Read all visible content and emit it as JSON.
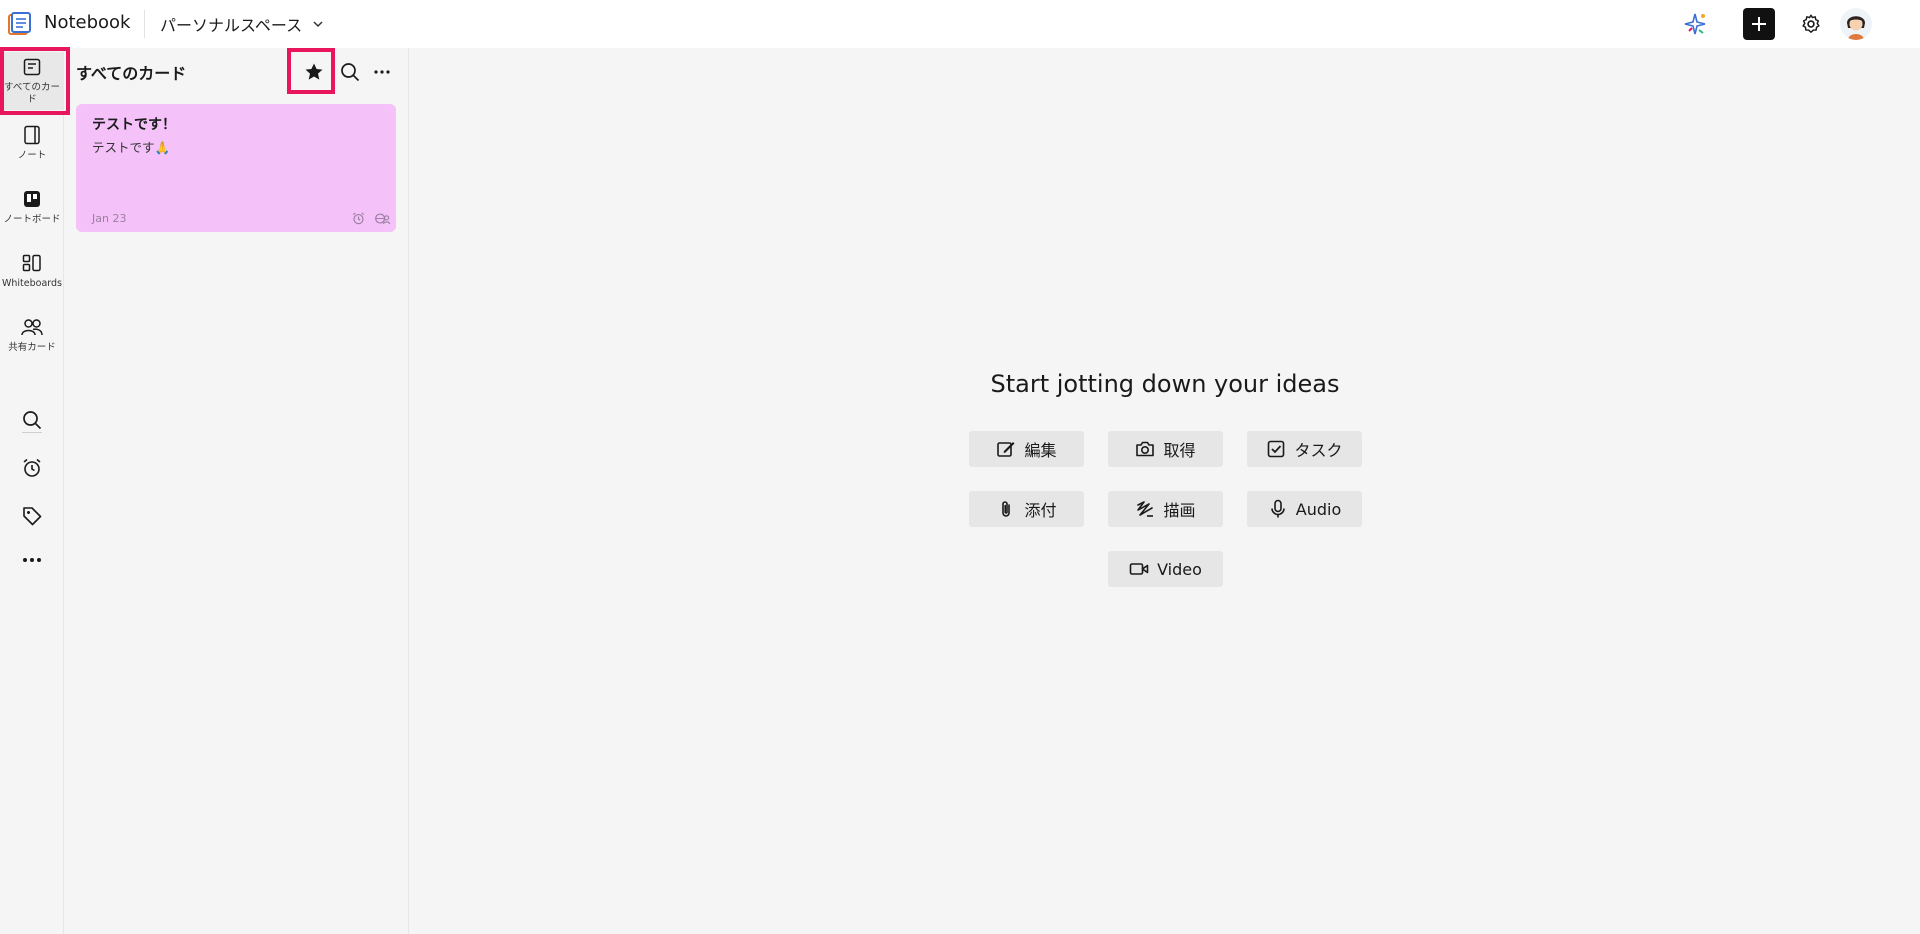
{
  "app": {
    "name": "Notebook",
    "space": "パーソナルスペース"
  },
  "nav": {
    "items": [
      {
        "label": "すべてのカード",
        "icon": "cards-icon"
      },
      {
        "label": "ノート",
        "icon": "notebook-icon"
      },
      {
        "label": "ノートボード",
        "icon": "board-icon"
      },
      {
        "label": "Whiteboards",
        "icon": "whiteboard-icon"
      },
      {
        "label": "共有カード",
        "icon": "people-icon"
      }
    ],
    "tools": [
      "search-icon",
      "alarm-icon",
      "tag-icon",
      "more-icon"
    ]
  },
  "list": {
    "title": "すべてのカード",
    "cards": [
      {
        "title": "テストです！",
        "body": "テストです🙏",
        "date": "Jan 23",
        "color": "#f4c2f9"
      }
    ]
  },
  "main": {
    "empty_title": "Start jotting down your ideas",
    "actions": {
      "edit": "編集",
      "capture": "取得",
      "task": "タスク",
      "attach": "添付",
      "draw": "描画",
      "audio": "Audio",
      "video": "Video"
    }
  },
  "colors": {
    "highlight": "#e8175d",
    "card": "#f4c2f9",
    "background": "#f5f5f5"
  }
}
